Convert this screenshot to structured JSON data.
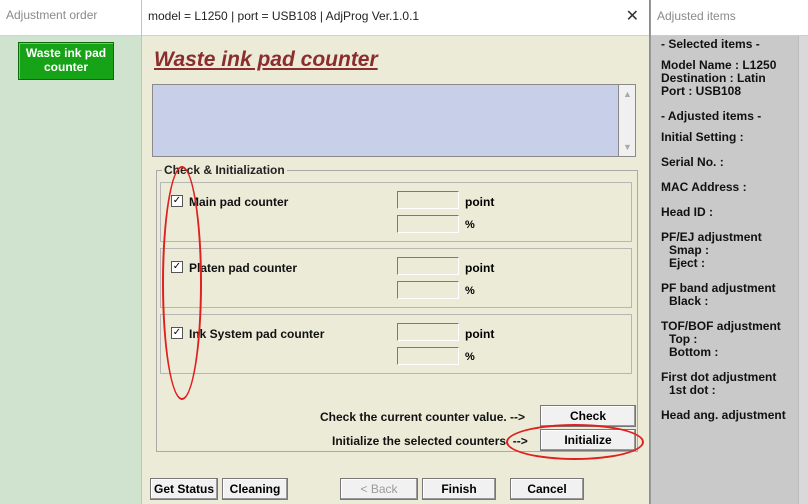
{
  "left_panel": {
    "header": "Adjustment order",
    "selected_item": "Waste ink pad counter"
  },
  "window": {
    "title": "model = L1250 | port = USB108 | AdjProg Ver.1.0.1",
    "close_glyph": "✕"
  },
  "main": {
    "title": "Waste ink pad counter",
    "group_title": "Check & Initialization",
    "counters": [
      {
        "label": "Main pad counter",
        "checked": "✓",
        "unit_point": "point",
        "unit_percent": "%"
      },
      {
        "label": "Platen pad counter",
        "checked": "✓",
        "unit_point": "point",
        "unit_percent": "%"
      },
      {
        "label": "Ink System pad counter",
        "checked": "✓",
        "unit_point": "point",
        "unit_percent": "%"
      }
    ],
    "check_text": "Check the current counter value. -->",
    "check_button": "Check",
    "init_text": "Initialize the selected counters. -->",
    "init_button": "Initialize"
  },
  "bottom": {
    "get_status": "Get Status",
    "cleaning": "Cleaning",
    "back": "< Back",
    "finish": "Finish",
    "cancel": "Cancel"
  },
  "right_panel": {
    "header": "Adjusted items",
    "selected_heading": "- Selected items -",
    "model": "Model Name : L1250",
    "destination": "Destination : Latin",
    "port": "Port : USB108",
    "adjusted_heading": "- Adjusted items -",
    "initial_setting": "Initial Setting :",
    "serial": "Serial No. :",
    "mac": "MAC Address :",
    "head_id": "Head ID :",
    "pfej": "PF/EJ adjustment",
    "smap": "Smap :",
    "eject": "Eject :",
    "pf_band": "PF band adjustment",
    "black": "Black :",
    "tofbof": "TOF/BOF adjustment",
    "top": "Top :",
    "bottom": "Bottom :",
    "first_dot": "First dot adjustment",
    "first_dot_val": "1st dot :",
    "head_ang": "Head ang. adjustment"
  },
  "colors": {
    "title_red": "#8b2d2d",
    "selected_green": "#17a317",
    "annotation_red": "#e02020",
    "message_blue": "#c8cfe8"
  }
}
